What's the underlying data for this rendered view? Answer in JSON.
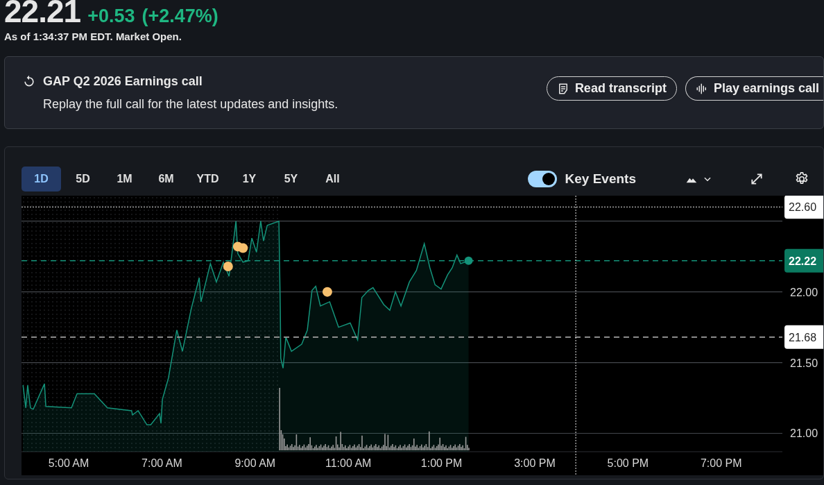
{
  "quote": {
    "price": "22.21",
    "change": "+0.53",
    "change_percent": "(+2.47%)",
    "as_of": "As of 1:34:37 PM EDT. Market Open."
  },
  "earnings_banner": {
    "title": "GAP Q2 2026 Earnings call",
    "subtitle": "Replay the full call for the latest updates and insights.",
    "buttons": [
      {
        "label": "Read transcript",
        "kind": "transcript"
      },
      {
        "label": "Play earnings call",
        "kind": "audio"
      }
    ]
  },
  "chart_panel": {
    "ranges": [
      {
        "label": "1D",
        "selected": true
      },
      {
        "label": "5D",
        "selected": false
      },
      {
        "label": "1M",
        "selected": false
      },
      {
        "label": "6M",
        "selected": false
      },
      {
        "label": "YTD",
        "selected": false
      },
      {
        "label": "1Y",
        "selected": false
      },
      {
        "label": "5Y",
        "selected": false
      },
      {
        "label": "All",
        "selected": false
      }
    ],
    "key_events": {
      "label": "Key Events",
      "on": true
    },
    "chart_data": {
      "type": "area",
      "x": [
        4.02,
        4.08,
        4.12,
        4.18,
        4.24,
        4.48,
        4.51,
        5.06,
        5.18,
        5.55,
        5.83,
        6.35,
        6.37,
        6.49,
        6.68,
        6.76,
        6.95,
        6.98,
        7.01,
        7.14,
        7.32,
        7.44,
        7.63,
        7.8,
        7.84,
        8.04,
        8.17,
        8.32,
        8.44,
        8.51,
        8.59,
        8.63,
        8.74,
        8.85,
        8.93,
        9.03,
        9.12,
        9.18,
        9.26,
        9.51,
        9.54,
        9.55,
        9.6,
        9.66,
        9.78,
        10.0,
        10.12,
        10.22,
        10.3,
        10.4,
        10.6,
        10.79,
        11.04,
        11.2,
        11.29,
        11.43,
        11.53,
        11.76,
        11.89,
        12.01,
        12.13,
        12.31,
        12.46,
        12.63,
        12.75,
        12.86,
        12.99,
        13.13,
        13.23,
        13.33,
        13.41,
        13.5,
        13.58
      ],
      "series": [
        {
          "color": "#14937a",
          "values": [
            21.34,
            21.18,
            21.34,
            21.18,
            21.17,
            21.35,
            21.19,
            21.18,
            21.28,
            21.28,
            21.18,
            21.16,
            21.13,
            21.16,
            21.06,
            21.06,
            21.14,
            21.07,
            21.24,
            21.39,
            21.73,
            21.58,
            21.88,
            22.1,
            21.93,
            22.2,
            22.07,
            22.21,
            22.11,
            22.29,
            22.5,
            22.27,
            22.21,
            22.22,
            22.38,
            22.28,
            22.5,
            22.36,
            22.47,
            22.5,
            21.88,
            21.53,
            21.46,
            21.68,
            21.58,
            21.63,
            21.73,
            22.01,
            22.04,
            21.9,
            21.93,
            21.75,
            21.78,
            21.66,
            21.96,
            22.01,
            22.03,
            21.91,
            21.87,
            22.0,
            21.9,
            22.07,
            22.15,
            22.34,
            22.17,
            22.05,
            22.02,
            22.12,
            22.17,
            22.26,
            22.2,
            22.21,
            22.22
          ]
        }
      ],
      "xlim": [
        3.988,
        20.313
      ],
      "ylim": [
        20.87,
        22.68
      ],
      "grid": true,
      "xticks": [
        {
          "value": 5,
          "label": "5:00 AM"
        },
        {
          "value": 7,
          "label": "7:00 AM"
        },
        {
          "value": 9,
          "label": "9:00 AM"
        },
        {
          "value": 11,
          "label": "11:00 AM"
        },
        {
          "value": 13,
          "label": "1:00 PM"
        },
        {
          "value": 15,
          "label": "3:00 PM"
        },
        {
          "value": 17,
          "label": "5:00 PM"
        },
        {
          "value": 19,
          "label": "7:00 PM"
        }
      ],
      "yticks": [
        {
          "value": 21,
          "label": "21.00"
        },
        {
          "value": 21.5,
          "label": "21.50"
        },
        {
          "value": 22,
          "label": "22.00"
        }
      ],
      "ref_lines": [
        {
          "axis": "y",
          "value": 21.68,
          "label": "21.68",
          "color": "#a0a0a0"
        },
        {
          "axis": "y",
          "value": 22.22,
          "label": "22.22",
          "color": "#14937a"
        },
        {
          "axis": "y",
          "value": 22.6,
          "label": "22.60",
          "color": "#e8e8e8"
        },
        {
          "axis": "x",
          "value": 15.88,
          "color": "#e8e8e8"
        }
      ]
    }
  }
}
